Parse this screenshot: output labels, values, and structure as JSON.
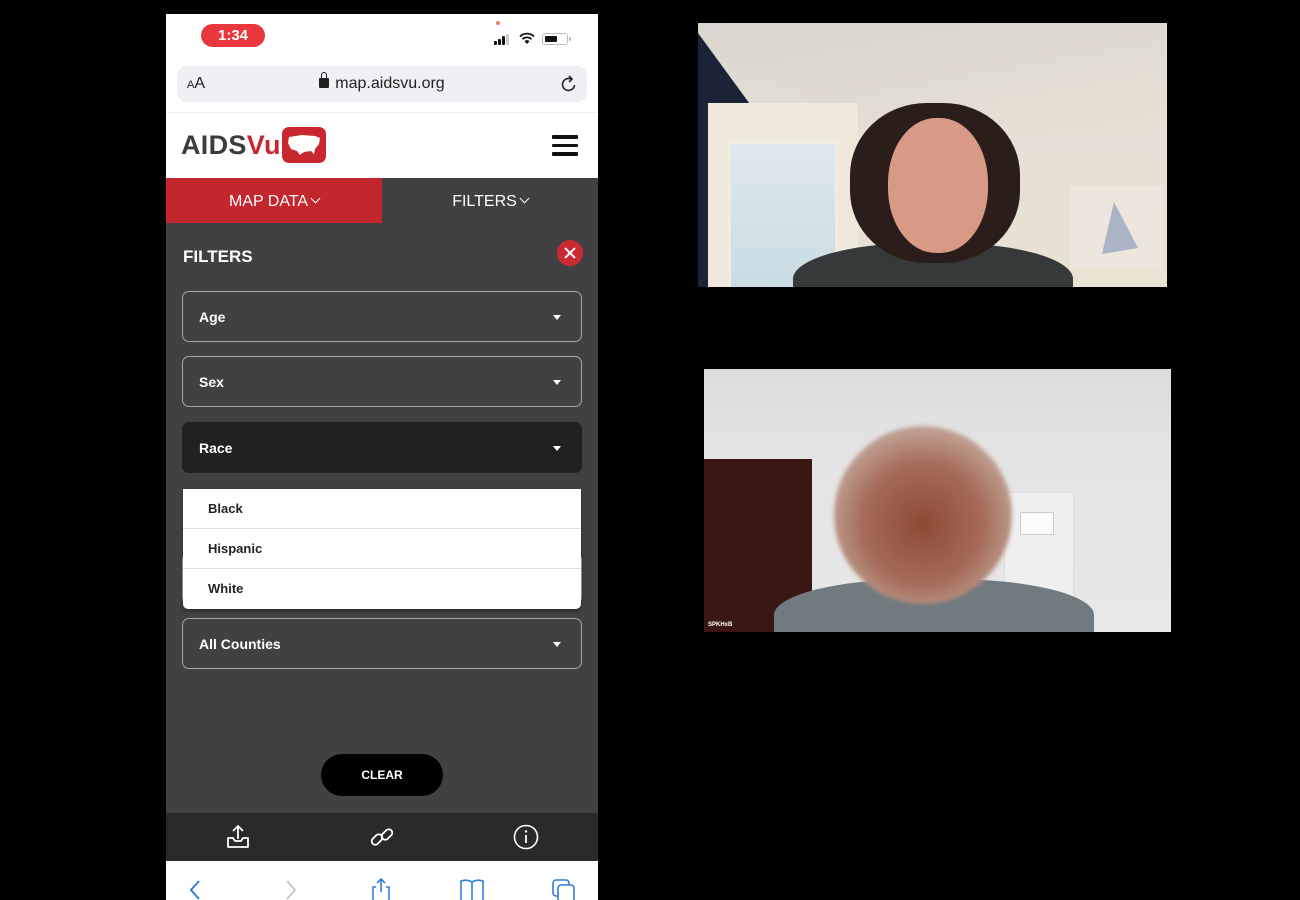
{
  "status_bar": {
    "time": "1:34",
    "battery_level": 0.6,
    "signal_bars": 4
  },
  "browser": {
    "text_size_label_small": "A",
    "text_size_label_large": "A",
    "url": "map.aidsvu.org",
    "icons": {
      "lock": "lock-icon",
      "reload": "reload-icon"
    }
  },
  "site": {
    "logo_part1": "AIDS",
    "logo_part2": "Vu",
    "brand_color": "#c8272f",
    "menu_icon": "hamburger-icon"
  },
  "tabs": [
    {
      "label": "MAP DATA",
      "active": true
    },
    {
      "label": "FILTERS",
      "active": false
    }
  ],
  "filters_panel": {
    "title": "FILTERS",
    "close_icon": "close-icon",
    "selects": [
      {
        "label": "Age"
      },
      {
        "label": "Sex"
      },
      {
        "label": "Race",
        "open": true
      },
      {
        "label": ""
      },
      {
        "label": "All Counties"
      }
    ],
    "race_options": [
      "Black",
      "Hispanic",
      "White"
    ],
    "clear_label": "CLEAR"
  },
  "action_bar": {
    "icons": [
      "download-icon",
      "link-icon",
      "info-icon"
    ]
  },
  "safari_toolbar": {
    "icons": [
      "back-icon",
      "forward-icon",
      "share-icon",
      "bookmarks-icon",
      "tabs-icon"
    ]
  },
  "video_call": {
    "participants": [
      {
        "name": ""
      },
      {
        "name": "SPKHxB"
      }
    ]
  }
}
